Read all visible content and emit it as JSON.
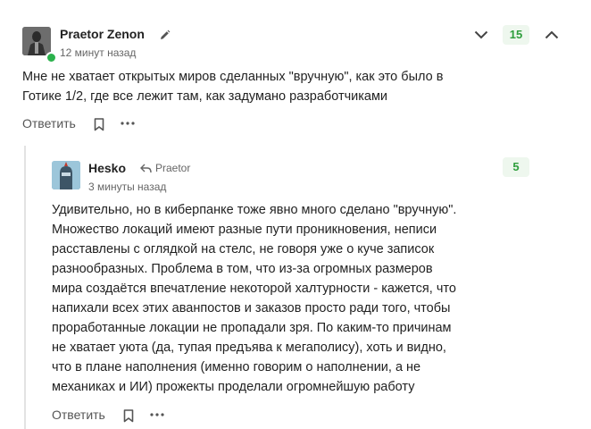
{
  "comment": {
    "username": "Praetor Zenon",
    "time": "12 минут назад",
    "score": "15",
    "text_lines": [
      "Мне не хватает открытых миров сделанных \"вручную\", как это было в",
      "Готике 1/2, где все лежит там, как задумано разработчиками"
    ],
    "reply_label": "Ответить"
  },
  "reply": {
    "username": "Hesko",
    "reply_to": "Praetor",
    "time": "3 минуты назад",
    "score": "5",
    "text_lines": [
      "Удивительно, но в киберпанке тоже явно много сделано \"вручную\".",
      "Множество локаций имеют разные пути проникновения, неписи",
      "расставлены с оглядкой на стелс, не говоря уже о куче записок",
      "разнообразных. Проблема в том, что из-за огромных размеров",
      "мира создаётся впечатление некоторой халтурности - кажется, что",
      "напихали всех этих аванпостов и заказов просто ради того, чтобы",
      "проработанные локации не пропадали зря. По каким-то причинам",
      "не хватает уюта (да, тупая предъява к мегаполису), хоть и видно,",
      "что в плане наполнения (именно говорим о наполнении, а не",
      "механиках и ИИ) прожекты проделали огромнейшую работу"
    ],
    "reply_label": "Ответить"
  },
  "colors": {
    "score_text": "#2e9e3c",
    "score_bg": "#eef7ee",
    "online": "#2bb24c"
  }
}
